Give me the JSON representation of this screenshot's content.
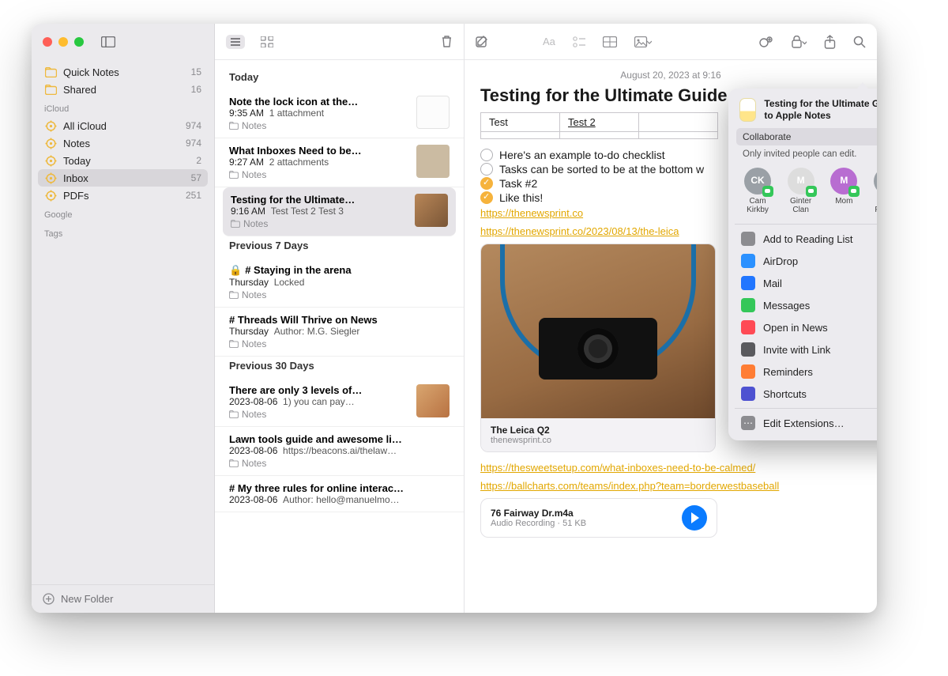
{
  "sidebar": {
    "top_items": [
      {
        "label": "Quick Notes",
        "count": "15",
        "hex": "#eeb93e"
      },
      {
        "label": "Shared",
        "count": "16",
        "hex": "#eeb93e"
      }
    ],
    "groups": [
      {
        "name": "iCloud",
        "items": [
          {
            "label": "All iCloud",
            "count": "974"
          },
          {
            "label": "Notes",
            "count": "974"
          },
          {
            "label": "Today",
            "count": "2"
          },
          {
            "label": "Inbox",
            "count": "57",
            "selected": true
          },
          {
            "label": "PDFs",
            "count": "251"
          }
        ]
      },
      {
        "name": "Google",
        "items": []
      },
      {
        "name": "Tags",
        "items": []
      }
    ],
    "footer": "New Folder"
  },
  "list": {
    "sections": [
      {
        "header": "Today",
        "items": [
          {
            "title": "Note the lock icon at the…",
            "time": "9:35 AM",
            "preview": "1 attachment",
            "folder": "Notes",
            "thumb": "white"
          },
          {
            "title": "What Inboxes Need to be…",
            "time": "9:27 AM",
            "preview": "2 attachments",
            "folder": "Notes",
            "thumb": "people"
          },
          {
            "title": "Testing for the Ultimate…",
            "time": "9:16 AM",
            "preview": "Test Test 2 Test 3",
            "folder": "Notes",
            "thumb": "camera",
            "selected": true
          }
        ]
      },
      {
        "header": "Previous 7 Days",
        "items": [
          {
            "title": "# Staying in the arena",
            "time": "Thursday",
            "preview": "Locked",
            "folder": "Notes",
            "locked": true
          },
          {
            "title": "# Threads Will Thrive on News",
            "time": "Thursday",
            "preview": "Author: M.G. Siegler",
            "folder": "Notes"
          }
        ]
      },
      {
        "header": "Previous 30 Days",
        "items": [
          {
            "title": "There are only 3 levels of…",
            "time": "2023-08-06",
            "preview": "1) you can pay…",
            "folder": "Notes",
            "thumb": "face"
          },
          {
            "title": "Lawn tools guide and awesome li…",
            "time": "2023-08-06",
            "preview": "https://beacons.ai/thelaw…",
            "folder": "Notes"
          },
          {
            "title": "# My three rules for online interac…",
            "time": "2023-08-06",
            "preview": "Author: hello@manuelmo…",
            "folder": ""
          }
        ]
      }
    ]
  },
  "note": {
    "timestamp": "August 20, 2023 at 9:16",
    "title": "Testing for the Ultimate Guide",
    "table": {
      "cell1": "Test",
      "cell2": "Test 2"
    },
    "checks": [
      {
        "done": false,
        "text": "Here's an example to-do checklist"
      },
      {
        "done": false,
        "text": "Tasks can be sorted to be at the bottom w"
      },
      {
        "done": true,
        "text": "Task #2"
      },
      {
        "done": true,
        "text": "Like this!"
      }
    ],
    "links": [
      "https://thenewsprint.co",
      "https://thenewsprint.co/2023/08/13/the-leica"
    ],
    "link_card": {
      "title": "The Leica Q2",
      "source": "thenewsprint.co"
    },
    "links2": [
      "https://thesweetsetup.com/what-inboxes-need-to-be-calmed/",
      "https://ballcharts.com/teams/index.php?team=borderwestbaseball"
    ],
    "audio": {
      "title": "76 Fairway Dr.m4a",
      "meta": "Audio Recording · 51 KB"
    }
  },
  "share": {
    "title": "Testing for the Ultimate Guide to Apple Notes",
    "collab_label": "Collaborate",
    "perm": "Only invited people can edit.",
    "contacts": [
      {
        "initials": "CK",
        "name": "Cam Kirkby",
        "cls": "av1"
      },
      {
        "initials": "M",
        "name": "Ginter Clan",
        "cls": "av2"
      },
      {
        "initials": "M",
        "name": "Mom",
        "cls": "av3"
      },
      {
        "initials": "JF",
        "name": "John Froese",
        "cls": "av4"
      }
    ],
    "apps": [
      {
        "label": "Add to Reading List",
        "cls": "gray"
      },
      {
        "label": "AirDrop",
        "cls": "blue"
      },
      {
        "label": "Mail",
        "cls": "bl2"
      },
      {
        "label": "Messages",
        "cls": "green"
      },
      {
        "label": "Open in News",
        "cls": "red"
      },
      {
        "label": "Invite with Link",
        "cls": "dg"
      },
      {
        "label": "Reminders",
        "cls": "orange"
      },
      {
        "label": "Shortcuts",
        "cls": "purple"
      }
    ],
    "edit_ext": "Edit Extensions…"
  }
}
